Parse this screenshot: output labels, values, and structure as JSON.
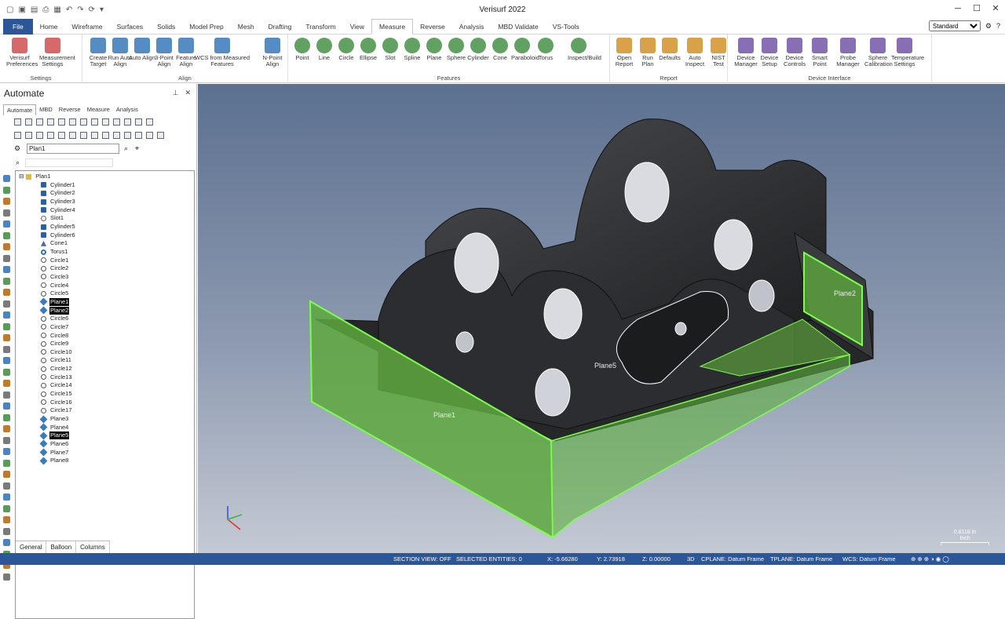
{
  "app_title": "Verisurf 2022",
  "ribbon_tabs": [
    "File",
    "Home",
    "Wireframe",
    "Surfaces",
    "Solids",
    "Model Prep",
    "Mesh",
    "Drafting",
    "Transform",
    "View",
    "Measure",
    "Reverse",
    "Analysis",
    "MBD Validate",
    "VS-Tools"
  ],
  "active_tab": "Measure",
  "workspace_select": "Standard",
  "ribbon": {
    "settings": {
      "label": "Settings",
      "buttons": [
        "Verisurf Preferences",
        "Measurement Settings"
      ]
    },
    "align": {
      "label": "Align",
      "buttons": [
        "Create Target",
        "Run Auto Align",
        "Auto Align",
        "3-Point Align",
        "Feature Align",
        "WCS from Measured Features",
        "N-Point Align"
      ]
    },
    "features": {
      "label": "Features",
      "buttons": [
        "Point",
        "Line",
        "Circle",
        "Ellipse",
        "Slot",
        "Spline",
        "Plane",
        "Sphere",
        "Cylinder",
        "Cone",
        "Paraboloid",
        "Torus",
        "Inspect/Build"
      ]
    },
    "report": {
      "label": "Report",
      "buttons": [
        "Open Report",
        "Run Plan",
        "Defaults",
        "Auto Inspect",
        "NIST Test"
      ]
    },
    "device": {
      "label": "Device Interface",
      "buttons": [
        "Device Manager",
        "Device Setup",
        "Device Controls",
        "Smart Point",
        "Probe Manager",
        "Sphere Calibration",
        "Temperature Settings"
      ]
    }
  },
  "panel": {
    "title": "Automate",
    "tabs": [
      "Automate",
      "MBD",
      "Reverse",
      "Measure",
      "Analysis"
    ],
    "plan_select": "Plan1",
    "bottom_tabs": [
      "General",
      "Balloon",
      "Columns"
    ]
  },
  "tree": {
    "root": "Plan1",
    "items": [
      {
        "label": "Cylinder1",
        "icon": "cylinder"
      },
      {
        "label": "Cylinder2",
        "icon": "cylinder"
      },
      {
        "label": "Cylinder3",
        "icon": "cylinder"
      },
      {
        "label": "Cylinder4",
        "icon": "cylinder"
      },
      {
        "label": "Slot1",
        "icon": "slot"
      },
      {
        "label": "Cylinder5",
        "icon": "cylinder"
      },
      {
        "label": "Cylinder6",
        "icon": "cylinder"
      },
      {
        "label": "Cone1",
        "icon": "cone"
      },
      {
        "label": "Torus1",
        "icon": "torus"
      },
      {
        "label": "Circle1",
        "icon": "circle"
      },
      {
        "label": "Circle2",
        "icon": "circle"
      },
      {
        "label": "Circle3",
        "icon": "circle"
      },
      {
        "label": "Circle4",
        "icon": "circle"
      },
      {
        "label": "Circle5",
        "icon": "circle"
      },
      {
        "label": "Plane1",
        "icon": "plane",
        "selected": true
      },
      {
        "label": "Plane2",
        "icon": "plane",
        "selected": true
      },
      {
        "label": "Circle6",
        "icon": "circle"
      },
      {
        "label": "Circle7",
        "icon": "circle"
      },
      {
        "label": "Circle8",
        "icon": "circle"
      },
      {
        "label": "Circle9",
        "icon": "circle"
      },
      {
        "label": "Circle10",
        "icon": "circle"
      },
      {
        "label": "Circle11",
        "icon": "circle"
      },
      {
        "label": "Circle12",
        "icon": "circle"
      },
      {
        "label": "Circle13",
        "icon": "circle"
      },
      {
        "label": "Circle14",
        "icon": "circle"
      },
      {
        "label": "Circle15",
        "icon": "circle"
      },
      {
        "label": "Circle16",
        "icon": "circle"
      },
      {
        "label": "Circle17",
        "icon": "circle"
      },
      {
        "label": "Plane3",
        "icon": "plane"
      },
      {
        "label": "Plane4",
        "icon": "plane"
      },
      {
        "label": "Plane5",
        "icon": "plane",
        "selected": true
      },
      {
        "label": "Plane6",
        "icon": "plane"
      },
      {
        "label": "Plane7",
        "icon": "plane"
      },
      {
        "label": "Plane8",
        "icon": "plane"
      }
    ]
  },
  "viewport": {
    "labels": [
      "Plane1",
      "Plane2",
      "Plane5"
    ],
    "scale": {
      "value": "0.8118 in",
      "unit": "Inch"
    },
    "highlight_color": "#5de03a",
    "part_color": "#2a2b2d"
  },
  "status": {
    "section_view": "SECTION VIEW: OFF",
    "selected": "SELECTED ENTITIES: 0",
    "x": "X:  -5.66280",
    "y": "Y:  2.73918",
    "z": "Z:  0.00000",
    "mode": "3D",
    "cplane": "CPLANE: Datum Frame",
    "tplane": "TPLANE: Datum Frame",
    "wcs": "WCS: Datum Frame"
  }
}
